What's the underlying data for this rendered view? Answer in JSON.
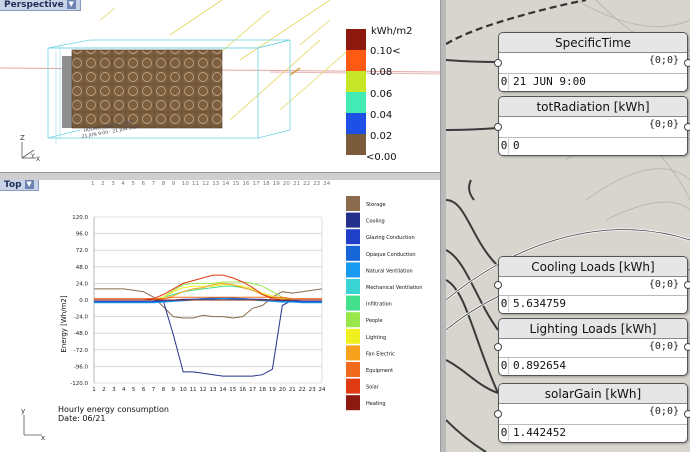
{
  "perspective": {
    "tab_label": "Perspective",
    "legend": {
      "title": "kWh/m2",
      "labels": [
        "0.10<",
        "0.08",
        "0.06",
        "0.04",
        "0.02",
        "<0.00"
      ],
      "colors": [
        "#8e1a0f",
        "#ff5a14",
        "#c8e628",
        "#44eab4",
        "#1e50e6",
        "#7a5b3c"
      ]
    },
    "model_caption_lines": [
      "HOURLY_SOLAR_LOAD",
      "21 JUN 9:00 - 21 JUN 9:00"
    ],
    "axis_labels": {
      "z": "Z",
      "y": "Y",
      "x": "X"
    }
  },
  "top_view": {
    "tab_label": "Top",
    "hour_ticks": [
      "1",
      "2",
      "3",
      "4",
      "5",
      "6",
      "7",
      "8",
      "9",
      "10",
      "11",
      "12",
      "13",
      "14",
      "15",
      "16",
      "17",
      "18",
      "19",
      "20",
      "21",
      "22",
      "23",
      "24"
    ],
    "footer_title": "Hourly energy consumption",
    "footer_date": "Date: 06/21",
    "axis_labels": {
      "y": "y",
      "x": "x"
    }
  },
  "chart_data": {
    "type": "line",
    "ylabel": "Energy [Wh/m2]",
    "ylim": [
      -120,
      120
    ],
    "yticks": [
      "120.0",
      "96.0",
      "72.0",
      "48.0",
      "24.0",
      "0.0",
      "-24.0",
      "-48.0",
      "-72.0",
      "-96.0",
      "-120.0"
    ],
    "x": [
      1,
      2,
      3,
      4,
      5,
      6,
      7,
      8,
      9,
      10,
      11,
      12,
      13,
      14,
      15,
      16,
      17,
      18,
      19,
      20,
      21,
      22,
      23,
      24
    ],
    "xticks": [
      "1",
      "2",
      "3",
      "4",
      "5",
      "6",
      "7",
      "8",
      "9",
      "10",
      "11",
      "12",
      "13",
      "14",
      "15",
      "16",
      "17",
      "18",
      "19",
      "20",
      "21",
      "22",
      "23",
      "24"
    ],
    "legend_position": "right",
    "series": [
      {
        "name": "Storage",
        "color": "#8b6b4d",
        "values": [
          16,
          16,
          16,
          16,
          14,
          12,
          4,
          -10,
          -24,
          -26,
          -26,
          -22,
          -24,
          -24,
          -26,
          -24,
          -12,
          -8,
          4,
          12,
          10,
          12,
          14,
          16
        ]
      },
      {
        "name": "Cooling",
        "color": "#25308a",
        "values": [
          0,
          0,
          0,
          0,
          0,
          0,
          0,
          -2,
          -50,
          -104,
          -104,
          -106,
          -108,
          -110,
          -110,
          -110,
          -110,
          -108,
          -100,
          -8,
          0,
          0,
          0,
          0
        ]
      },
      {
        "name": "Glazing Conduction",
        "color": "#1f3fc9",
        "values": [
          -2,
          -2,
          -2,
          -2,
          -2,
          -2,
          -2,
          -1,
          0,
          1,
          1,
          2,
          2,
          2,
          2,
          2,
          1,
          1,
          0,
          -1,
          -1,
          -2,
          -2,
          -2
        ]
      },
      {
        "name": "Opaque Conduction",
        "color": "#1565d6",
        "values": [
          -3,
          -3,
          -3,
          -3,
          -3,
          -3,
          -3,
          -2,
          -1,
          0,
          1,
          2,
          3,
          3,
          3,
          2,
          1,
          0,
          -1,
          -2,
          -2,
          -3,
          -3,
          -3
        ]
      },
      {
        "name": "Natural Ventilation",
        "color": "#1a9af0",
        "values": [
          -4,
          -4,
          -4,
          -4,
          -4,
          -4,
          -4,
          -3,
          -2,
          -1,
          0,
          1,
          1,
          2,
          1,
          1,
          0,
          -1,
          -2,
          -3,
          -3,
          -4,
          -4,
          -4
        ]
      },
      {
        "name": "Mechanical Ventilation",
        "color": "#3bd4d4",
        "values": [
          0,
          0,
          0,
          0,
          0,
          0,
          0,
          0,
          0,
          0,
          0,
          0,
          0,
          0,
          0,
          0,
          0,
          0,
          0,
          0,
          0,
          0,
          0,
          0
        ]
      },
      {
        "name": "Infiltration",
        "color": "#44e08e",
        "values": [
          0,
          0,
          0,
          0,
          0,
          0,
          0,
          4,
          8,
          12,
          14,
          16,
          18,
          20,
          20,
          18,
          14,
          8,
          4,
          2,
          0,
          0,
          0,
          0
        ]
      },
      {
        "name": "People",
        "color": "#98e84c",
        "values": [
          0,
          0,
          0,
          0,
          0,
          0,
          0,
          4,
          14,
          22,
          24,
          24,
          24,
          26,
          26,
          26,
          24,
          20,
          12,
          4,
          0,
          0,
          0,
          0
        ]
      },
      {
        "name": "Lighting",
        "color": "#f0f020",
        "values": [
          0,
          0,
          0,
          0,
          0,
          0,
          0,
          4,
          12,
          18,
          20,
          20,
          20,
          22,
          22,
          20,
          16,
          10,
          6,
          2,
          0,
          0,
          0,
          0
        ]
      },
      {
        "name": "Fan Electric",
        "color": "#f6a21c",
        "values": [
          0,
          0,
          0,
          0,
          0,
          0,
          0,
          2,
          6,
          12,
          16,
          18,
          22,
          24,
          22,
          18,
          14,
          8,
          4,
          2,
          0,
          0,
          0,
          0
        ]
      },
      {
        "name": "Equipment",
        "color": "#f06a1c",
        "values": [
          2,
          2,
          2,
          2,
          2,
          2,
          2,
          2,
          4,
          4,
          4,
          4,
          4,
          4,
          4,
          4,
          4,
          4,
          4,
          4,
          2,
          2,
          2,
          2
        ]
      },
      {
        "name": "Solar",
        "color": "#e03a12",
        "values": [
          0,
          0,
          0,
          0,
          0,
          0,
          2,
          8,
          16,
          24,
          28,
          32,
          36,
          36,
          32,
          26,
          18,
          8,
          2,
          0,
          0,
          0,
          0,
          0
        ]
      },
      {
        "name": "Heating",
        "color": "#8c1a10",
        "values": [
          0,
          0,
          0,
          0,
          0,
          0,
          0,
          0,
          0,
          0,
          0,
          0,
          0,
          0,
          0,
          0,
          0,
          0,
          0,
          0,
          0,
          0,
          0,
          0
        ]
      }
    ]
  },
  "grasshopper": {
    "panels": [
      {
        "title": "SpecificTime",
        "path": "{0;0}",
        "index": "0",
        "value": "21 JUN 9:00"
      },
      {
        "title": "totRadiation [kWh]",
        "path": "{0;0}",
        "index": "0",
        "value": "0"
      },
      {
        "title": "Cooling Loads [kWh]",
        "path": "{0;0}",
        "index": "0",
        "value": "5.634759"
      },
      {
        "title": "Lighting Loads [kWh]",
        "path": "{0;0}",
        "index": "0",
        "value": "0.892654"
      },
      {
        "title": "solarGain [kWh]",
        "path": "{0;0}",
        "index": "0",
        "value": "1.442452"
      }
    ]
  }
}
